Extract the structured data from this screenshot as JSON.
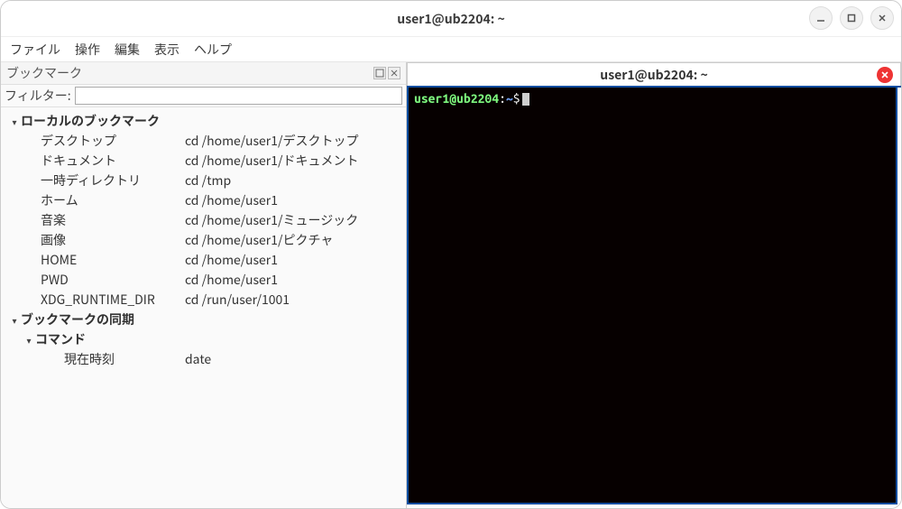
{
  "window": {
    "title": "user1@ub2204: ~"
  },
  "menubar": {
    "file": "ファイル",
    "actions": "操作",
    "edit": "編集",
    "view": "表示",
    "help": "ヘルプ"
  },
  "bookmarks_panel": {
    "title": "ブックマーク",
    "filter_label": "フィルター:",
    "filter_value": "",
    "groups": [
      {
        "label": "ローカルのブックマーク",
        "items": [
          {
            "name": "デスクトップ",
            "command": "cd /home/user1/デスクトップ"
          },
          {
            "name": "ドキュメント",
            "command": "cd /home/user1/ドキュメント"
          },
          {
            "name": "一時ディレクトリ",
            "command": "cd /tmp"
          },
          {
            "name": "ホーム",
            "command": "cd /home/user1"
          },
          {
            "name": "音楽",
            "command": "cd /home/user1/ミュージック"
          },
          {
            "name": "画像",
            "command": "cd /home/user1/ピクチャ"
          },
          {
            "name": "HOME",
            "command": "cd /home/user1"
          },
          {
            "name": "PWD",
            "command": "cd /home/user1"
          },
          {
            "name": "XDG_RUNTIME_DIR",
            "command": "cd /run/user/1001"
          }
        ]
      },
      {
        "label": "ブックマークの同期",
        "subgroups": [
          {
            "label": "コマンド",
            "items": [
              {
                "name": "現在時刻",
                "command": "date"
              }
            ]
          }
        ]
      }
    ]
  },
  "terminal_tab": {
    "title": "user1@ub2204: ~"
  },
  "terminal": {
    "prompt_user": "user1@ub2204",
    "prompt_colon": ":",
    "prompt_path": "~",
    "prompt_dollar": "$"
  }
}
